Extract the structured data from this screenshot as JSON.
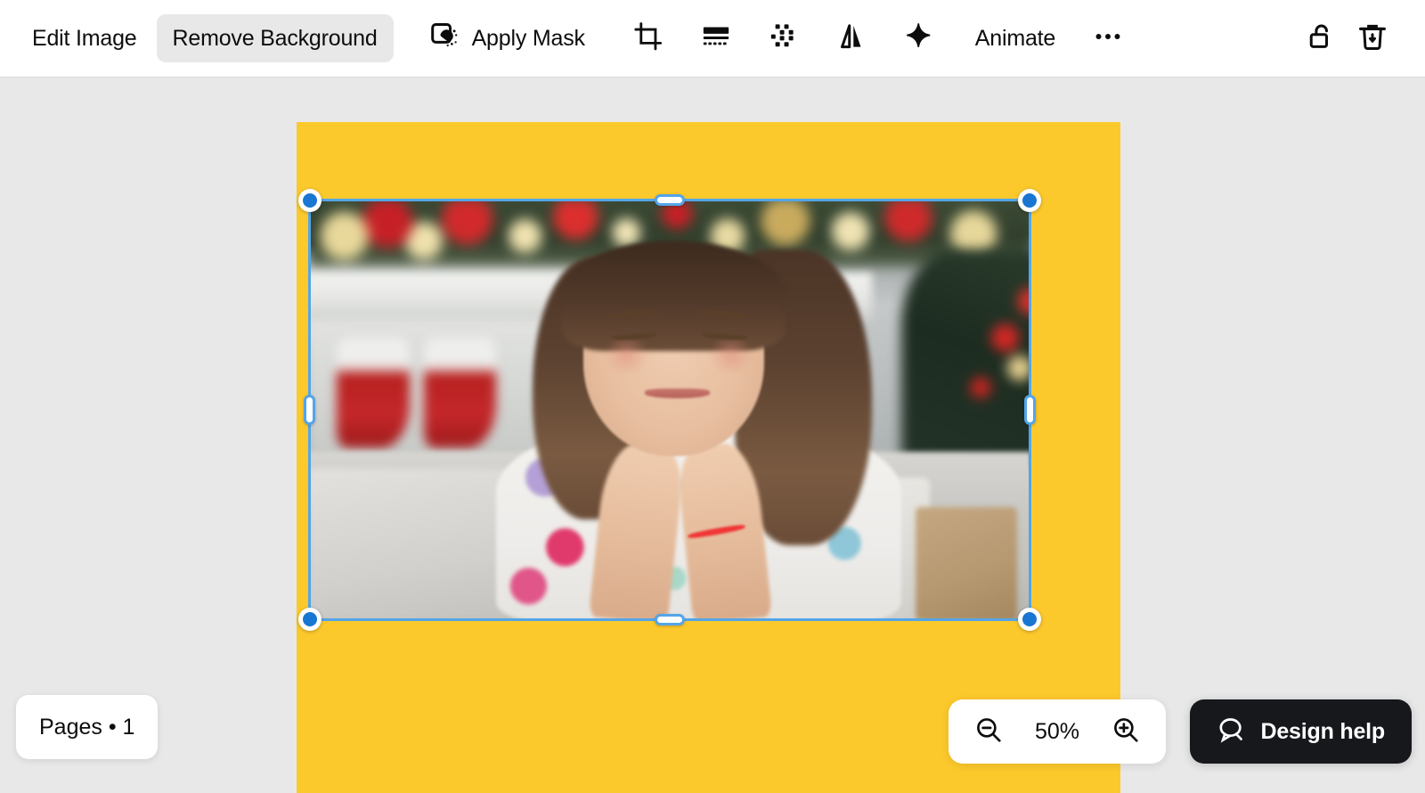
{
  "app": {
    "name": "design-editor",
    "workspace_bg": "#e8e8e9",
    "toolbar_bg": "#ffffff"
  },
  "toolbar": {
    "items": [
      {
        "id": "edit-image",
        "label": "Edit Image",
        "type": "text",
        "active": false
      },
      {
        "id": "remove-background",
        "label": "Remove Background",
        "type": "text",
        "active": true
      },
      {
        "id": "apply-mask",
        "label": "Apply Mask",
        "type": "icon-text",
        "icon": "mask-icon",
        "active": false
      },
      {
        "id": "crop",
        "label": "Crop",
        "type": "icon",
        "icon": "crop-icon"
      },
      {
        "id": "fade",
        "label": "Fade",
        "type": "icon",
        "icon": "fade-icon"
      },
      {
        "id": "effects",
        "label": "Effects",
        "type": "icon",
        "icon": "halftone-dots-icon"
      },
      {
        "id": "flip",
        "label": "Flip",
        "type": "icon",
        "icon": "flip-icon"
      },
      {
        "id": "magic",
        "label": "Magic",
        "type": "icon",
        "icon": "sparkle-icon"
      },
      {
        "id": "animate",
        "label": "Animate",
        "type": "text",
        "active": false
      },
      {
        "id": "more",
        "label": "More options",
        "type": "icon",
        "icon": "ellipsis-icon"
      },
      {
        "id": "lock",
        "label": "Lock",
        "type": "icon",
        "icon": "unlock-icon"
      },
      {
        "id": "delete",
        "label": "Delete",
        "type": "icon",
        "icon": "trash-icon"
      }
    ],
    "labels": {
      "edit_image": "Edit Image",
      "remove_background": "Remove Background",
      "apply_mask": "Apply Mask",
      "animate": "Animate"
    },
    "active_item": "Remove Background",
    "active_bg": "#e8e8e9"
  },
  "canvas": {
    "page_background_color": "#fcc92c",
    "selection": {
      "active": true,
      "outline_color": "#53a5e8",
      "handle_fill": "#1976d2",
      "handle_ring": "#ffffff",
      "corner_handles": 4,
      "edge_handles": 4
    },
    "image": {
      "description": "Smiling girl with closed eyes in polka-dot pajamas sitting on a sofa in front of a Christmas fireplace",
      "alt": "girl in christmas room"
    }
  },
  "footer": {
    "pages_label": "Pages • 1",
    "zoom": {
      "zoom_out_icon": "zoom-out-icon",
      "value": "50%",
      "zoom_in_icon": "zoom-in-icon"
    },
    "design_help": {
      "icon": "chat-bubble-icon",
      "label": "Design help",
      "background": "#16181c"
    }
  }
}
